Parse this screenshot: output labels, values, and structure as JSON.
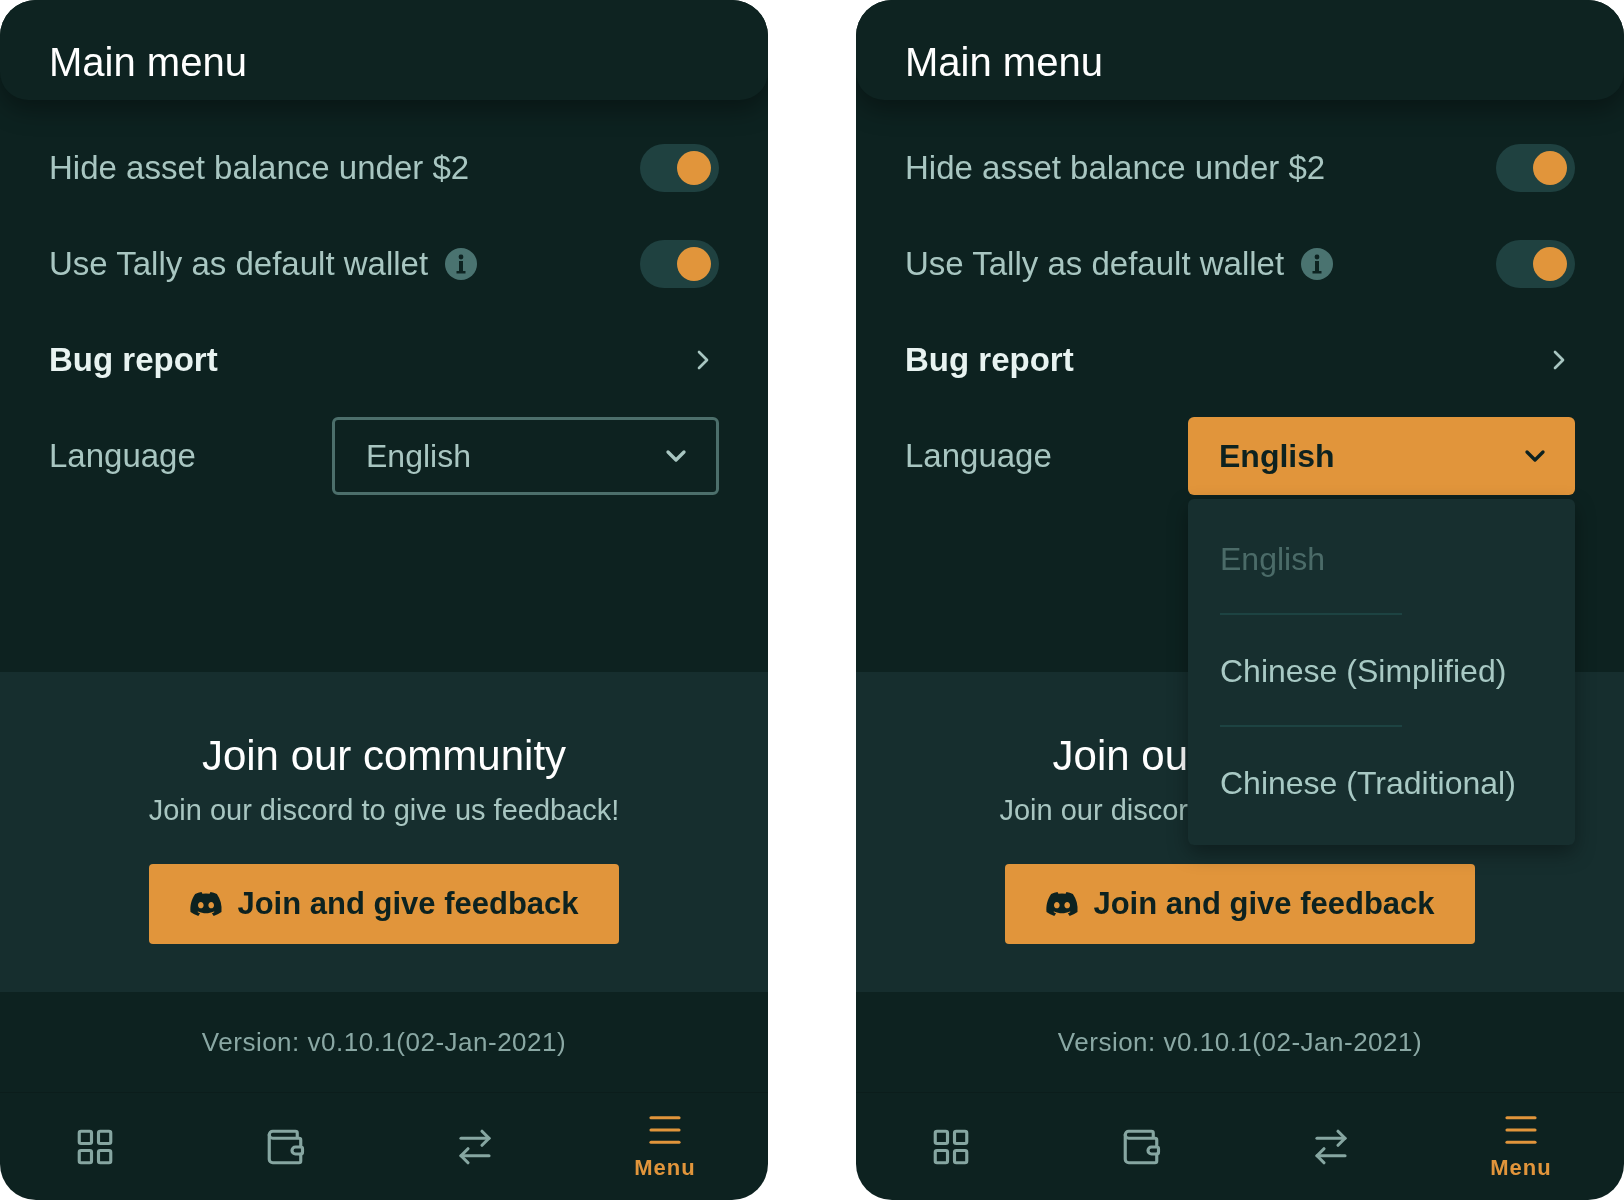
{
  "panels": [
    {
      "title": "Main menu",
      "settings": [
        {
          "kind": "toggle",
          "label": "Hide asset balance under $2",
          "on": true
        },
        {
          "kind": "toggle",
          "label": "Use Tally as default wallet",
          "info": true,
          "on": true
        },
        {
          "kind": "link",
          "label": "Bug report"
        }
      ],
      "language": {
        "label": "Language",
        "value": "English",
        "open": false
      },
      "community": {
        "title": "Join our community",
        "subtitle": "Join our discord to give us feedback!",
        "button": "Join and give feedback"
      },
      "version": "Version: v0.10.1(02-Jan-2021)",
      "nav": [
        {
          "selected": false
        },
        {
          "selected": false
        },
        {
          "selected": false
        },
        {
          "label": "Menu",
          "selected": true
        }
      ]
    },
    {
      "title": "Main menu",
      "settings": [
        {
          "kind": "toggle",
          "label": "Hide asset balance under $2",
          "on": true
        },
        {
          "kind": "toggle",
          "label": "Use Tally as default wallet",
          "info": true,
          "on": true
        },
        {
          "kind": "link",
          "label": "Bug report"
        }
      ],
      "language": {
        "label": "Language",
        "value": "English",
        "open": true,
        "options": [
          {
            "label": "English",
            "selected": true
          },
          {
            "label": "Chinese (Simplified)",
            "selected": false
          },
          {
            "label": "Chinese (Traditional)",
            "selected": false
          }
        ]
      },
      "community": {
        "title": "Join ou",
        "subtitle": "Join our discor",
        "button": "Join and give feedback"
      },
      "version": "Version: v0.10.1(02-Jan-2021)",
      "nav": [
        {
          "selected": false
        },
        {
          "selected": false
        },
        {
          "selected": false
        },
        {
          "label": "Menu",
          "selected": true
        }
      ]
    }
  ]
}
